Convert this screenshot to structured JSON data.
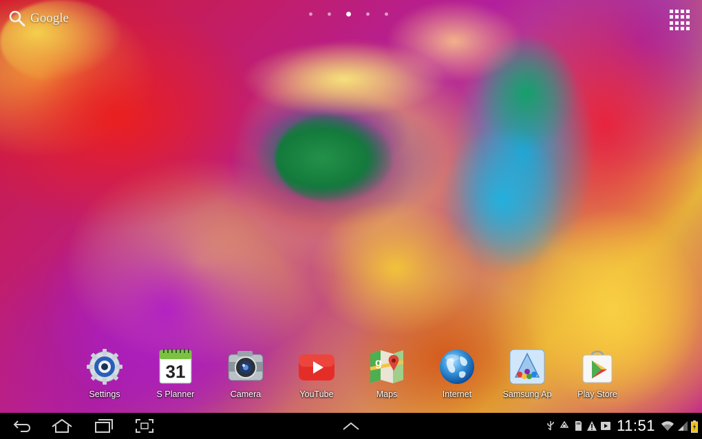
{
  "wallpaper": {
    "subject": "rainbow-rose-icon"
  },
  "google_search": {
    "label": "Google",
    "icon": "search-icon"
  },
  "page_indicator": {
    "count": 5,
    "active_index": 2
  },
  "apps_button": {
    "icon": "apps-grid-icon"
  },
  "dock": {
    "apps": [
      {
        "label": "Settings",
        "icon": "settings-gear-icon"
      },
      {
        "label": "S Planner",
        "icon": "calendar-icon",
        "day": "31"
      },
      {
        "label": "Camera",
        "icon": "camera-icon"
      },
      {
        "label": "YouTube",
        "icon": "youtube-icon"
      },
      {
        "label": "Maps",
        "icon": "maps-icon"
      },
      {
        "label": "Internet",
        "icon": "globe-icon"
      },
      {
        "label": "Samsung Ap",
        "icon": "samsung-apps-icon"
      },
      {
        "label": "Play Store",
        "icon": "play-store-icon"
      }
    ]
  },
  "nav_bar": {
    "back": "back-icon",
    "home": "home-icon",
    "recents": "recent-apps-icon",
    "screenshot": "screenshot-icon",
    "up": "chevron-up-icon"
  },
  "status_bar": {
    "time": "11:51",
    "icons": [
      "usb-icon",
      "recycle-icon",
      "sd-card-icon",
      "warning-icon",
      "play-icon",
      "wifi-icon",
      "signal-icon",
      "battery-icon"
    ],
    "battery_color": "#f0c419"
  },
  "colors": {
    "accent_red": "#e52d27",
    "text": "#ffffff"
  }
}
